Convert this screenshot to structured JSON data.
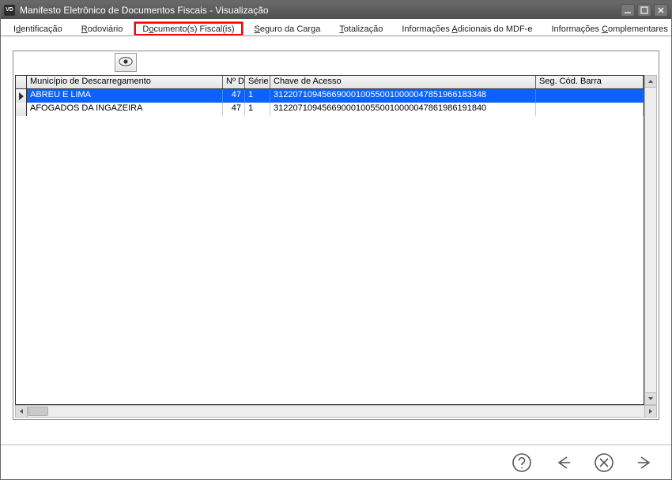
{
  "window": {
    "title": "Manifesto Eletrônico de Documentos Fiscais - Visualização",
    "badge": "VD"
  },
  "tabs": {
    "items": [
      {
        "pre": "I",
        "ul": "d",
        "post": "entificação"
      },
      {
        "pre": "",
        "ul": "R",
        "post": "odoviário"
      },
      {
        "pre": "D",
        "ul": "o",
        "post": "cumento(s) Fiscal(is)"
      },
      {
        "pre": "",
        "ul": "S",
        "post": "eguro da Carga"
      },
      {
        "pre": "",
        "ul": "T",
        "post": "otalização"
      },
      {
        "pre": "Informações ",
        "ul": "A",
        "post": "dicionais do MDF-e"
      },
      {
        "pre": "Informações ",
        "ul": "C",
        "post": "omplementares"
      }
    ],
    "active_index": 2
  },
  "grid": {
    "columns": {
      "municipio": "Município de Descarregamento",
      "num": "Nº D",
      "serie": "Série",
      "chave": "Chave de Acesso",
      "seg": "Seg. Cód. Barra"
    },
    "rows": [
      {
        "municipio": "ABREU E LIMA",
        "num": "47",
        "serie": "1",
        "chave": "31220710945669000100550010000047851966183348",
        "seg": "",
        "selected": true,
        "current": true
      },
      {
        "municipio": "AFOGADOS DA INGAZEIRA",
        "num": "47",
        "serie": "1",
        "chave": "31220710945669000100550010000047861986191840",
        "seg": "",
        "selected": false,
        "current": false
      }
    ]
  }
}
